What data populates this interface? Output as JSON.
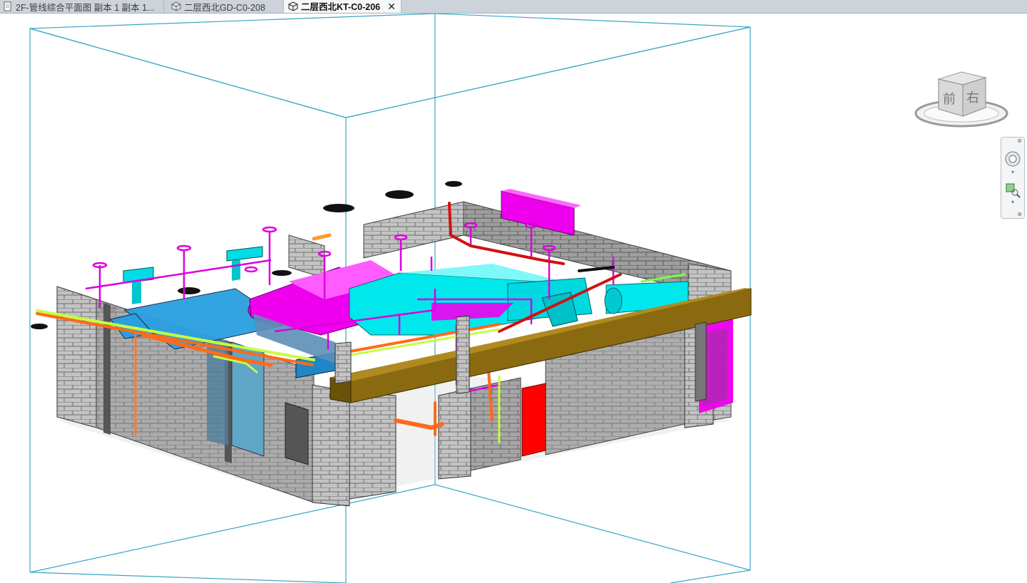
{
  "tabs": [
    {
      "label": "2F-管线综合平面图 副本 1 副本 1...",
      "type": "plan-view",
      "active": false
    },
    {
      "label": "二层西北GD-C0-208",
      "type": "3d-view",
      "active": false
    },
    {
      "label": "二层西北KT-C0-206",
      "type": "3d-view",
      "active": true,
      "close_label": "✕"
    }
  ],
  "viewcube": {
    "front_label": "前",
    "right_label": "右"
  },
  "nav_bar": {
    "items": [
      {
        "icon": "steering-wheel-icon"
      },
      {
        "icon": "zoom-region-icon"
      }
    ]
  },
  "colors": {
    "section_box": "#3aa6c4",
    "ductwork_cyan": "#00e7ec",
    "ductwork_magenta": "#ee00ee",
    "ductwork_blue": "#2a9fe0",
    "beam_brown": "#8a6a10",
    "pipe_red": "#d21010",
    "pipe_orange": "#ff6a1a",
    "pipe_yellow_green": "#c6ff40",
    "door_red": "#ff0000",
    "wall_gray": "#bfbfbf"
  }
}
